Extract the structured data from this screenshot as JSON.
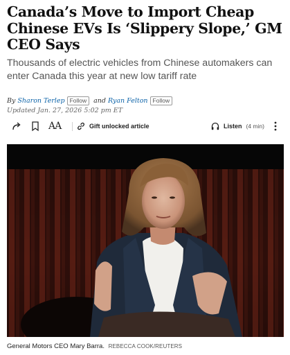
{
  "article": {
    "headline": "Canada’s Move to Import Cheap Chinese EVs Is ‘Slippery Slope,’ GM CEO Says",
    "dek": "Thousands of electric vehicles from Chinese automakers can enter Canada this year at new low tariff rate",
    "byline": {
      "prefix": "By",
      "author1": "Sharon Terlep",
      "follow1": "Follow",
      "conjunction": "and",
      "author2": "Ryan Felton",
      "follow2": "Follow"
    },
    "updated": "Updated Jan. 27, 2026 5:02 pm ET"
  },
  "toolbar": {
    "share_icon": "share-icon",
    "bookmark_icon": "bookmark-icon",
    "text_size_label": "AA",
    "gift_label": "Gift unlocked article",
    "listen_label": "Listen",
    "listen_duration": "(4 min)"
  },
  "photo": {
    "caption": "General Motors CEO Mary Barra.",
    "credit": "REBECCA COOK/REUTERS"
  }
}
